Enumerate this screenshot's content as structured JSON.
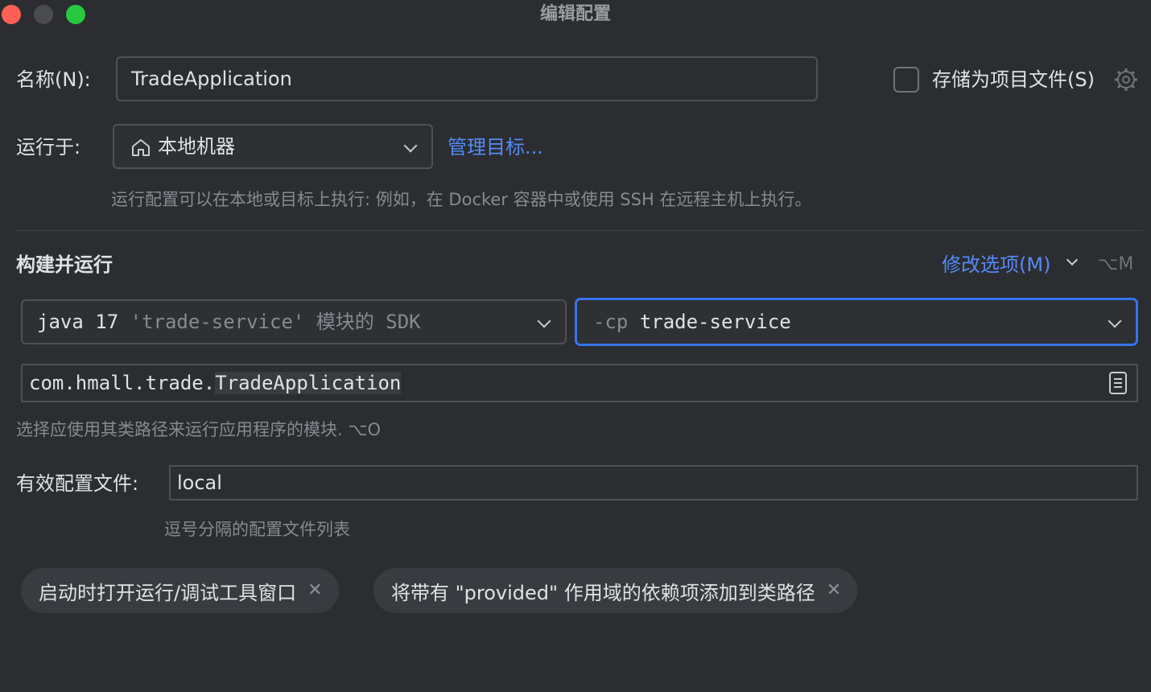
{
  "window": {
    "title": "编辑配置"
  },
  "name": {
    "label": "名称(N):",
    "value": "TradeApplication"
  },
  "store_as_file": {
    "label": "存储为项目文件(S)",
    "checked": false
  },
  "run_on": {
    "label": "运行于:",
    "value": "本地机器",
    "manage_link": "管理目标..."
  },
  "run_on_hint": "运行配置可以在本地或目标上执行: 例如，在 Docker 容器中或使用 SSH 在远程主机上执行。",
  "build_run": {
    "title": "构建并运行",
    "modify_options": "修改选项(M)",
    "modify_shortcut": "⌥M",
    "sdk": {
      "main": "java 17",
      "module": "'trade-service'",
      "suffix": "模块的 SDK"
    },
    "classpath": {
      "flag": "-cp",
      "module": "trade-service"
    },
    "main_class": {
      "prefix": "com.hmall.trade.",
      "name": "TradeApplication"
    },
    "classpath_hint": "选择应使用其类路径来运行应用程序的模块. ⌥O"
  },
  "profiles": {
    "label": "有效配置文件:",
    "value": "local",
    "hint": "逗号分隔的配置文件列表"
  },
  "options": [
    {
      "label": "启动时打开运行/调试工具窗口"
    },
    {
      "label": "将带有 \"provided\" 作用域的依赖项添加到类路径"
    }
  ]
}
